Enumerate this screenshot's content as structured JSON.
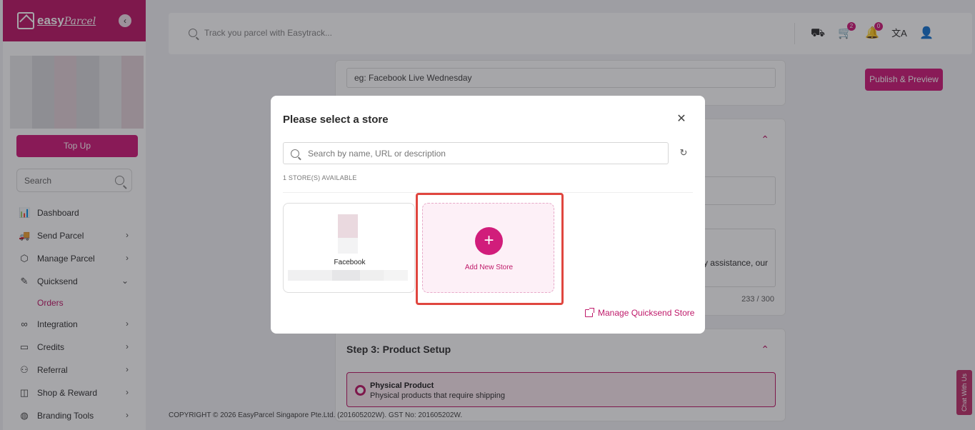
{
  "sidebar": {
    "brand_name": "easy",
    "brand_script": "Parcel",
    "collapse_glyph": "‹",
    "topup_label": "Top Up",
    "search_placeholder": "Search",
    "items": [
      {
        "label": "Dashboard",
        "icon": "bar-chart-icon",
        "glyph": "📊",
        "chevron": ""
      },
      {
        "label": "Send Parcel",
        "icon": "truck-icon",
        "glyph": "🚚",
        "chevron": "›"
      },
      {
        "label": "Manage Parcel",
        "icon": "box-icon",
        "glyph": "⬡",
        "chevron": "›"
      },
      {
        "label": "Quicksend",
        "icon": "quicksend-icon",
        "glyph": "✎",
        "chevron": "⌄"
      },
      {
        "label": "Integration",
        "icon": "link-icon",
        "glyph": "∞",
        "chevron": "›"
      },
      {
        "label": "Credits",
        "icon": "wallet-icon",
        "glyph": "▭",
        "chevron": "›"
      },
      {
        "label": "Referral",
        "icon": "user-plus-icon",
        "glyph": "⚇",
        "chevron": "›"
      },
      {
        "label": "Shop & Reward",
        "icon": "shopping-bag-icon",
        "glyph": "◫",
        "chevron": "›"
      },
      {
        "label": "Branding Tools",
        "icon": "palette-icon",
        "glyph": "◍",
        "chevron": "›"
      }
    ],
    "sub_item": "Orders"
  },
  "topbar": {
    "track_placeholder": "Track you parcel with Easytrack...",
    "cart_count": "2",
    "notif_count": "0"
  },
  "background": {
    "publish_label": "Publish & Preview",
    "event_name_value": "eg: Facebook Live Wednesday",
    "textarea_fragment": "ny assistance, our",
    "counter": "233 / 300",
    "step3_title": "Step 3: Product Setup",
    "physical_title": "Physical Product",
    "physical_sub": "Physical products that require shipping",
    "footer": "COPYRIGHT © 2026 EasyParcel Singapore Pte.Ltd. (201605202W). GST No: 201605202W.",
    "chat_label": "Chat With Us"
  },
  "modal": {
    "title": "Please select a store",
    "close_glyph": "✕",
    "search_placeholder": "Search by name, URL or description",
    "refresh_glyph": "↻",
    "available": "1 STORE(S) AVAILABLE",
    "stores": [
      {
        "name": "Facebook"
      }
    ],
    "add_glyph": "+",
    "add_label": "Add New Store",
    "manage_link": "Manage Quicksend Store"
  },
  "colors": {
    "brand": "#bf1a6a",
    "accent": "#d11d7b",
    "highlight": "#e0463f"
  }
}
